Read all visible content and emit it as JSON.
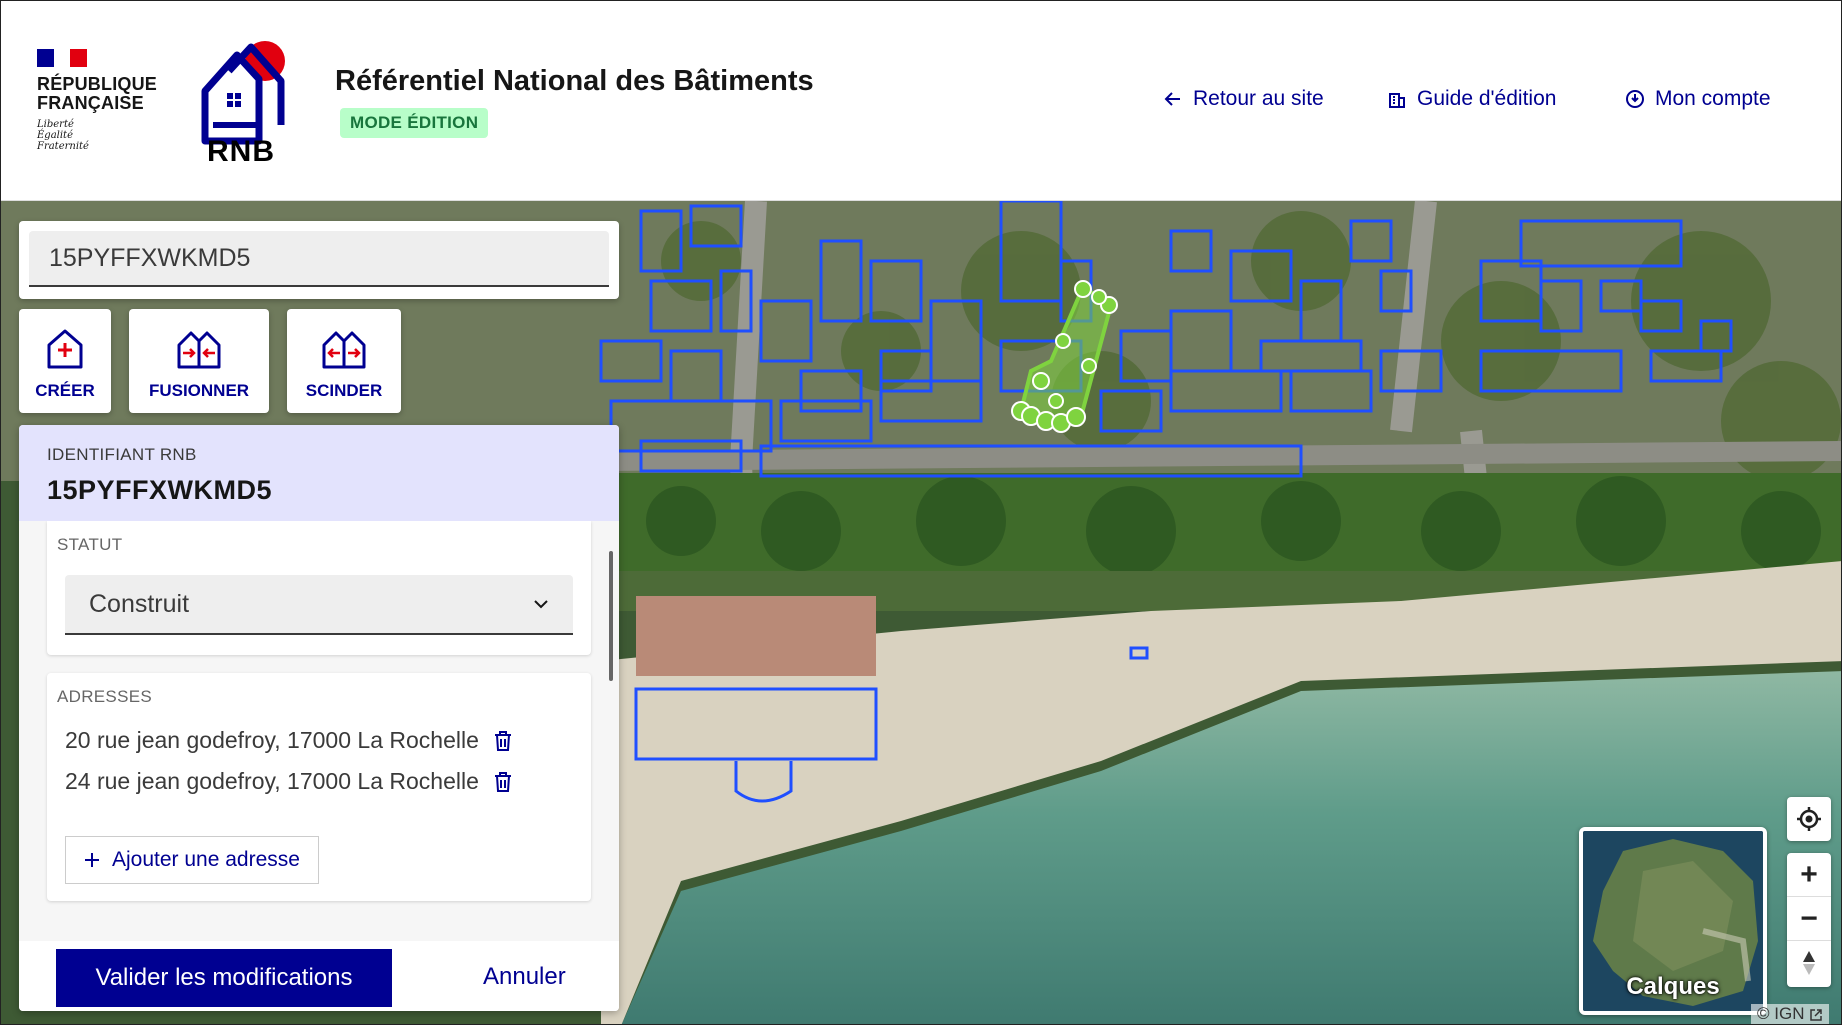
{
  "header": {
    "republic_line1": "RÉPUBLIQUE",
    "republic_line2": "FRANÇAISE",
    "motto_1": "Liberté",
    "motto_2": "Égalité",
    "motto_3": "Fraternité",
    "logo_text": "RNB",
    "title": "Référentiel National des Bâtiments",
    "mode_badge": "MODE ÉDITION",
    "nav": {
      "back": "Retour au site",
      "guide": "Guide d'édition",
      "account": "Mon compte"
    }
  },
  "search": {
    "value": "15PYFFXWKMD5"
  },
  "tools": {
    "create": "CRÉER",
    "merge": "FUSIONNER",
    "split": "SCINDER"
  },
  "panel": {
    "id_label": "IDENTIFIANT RNB",
    "id_value": "15PYFFXWKMD5",
    "status": {
      "label": "STATUT",
      "value": "Construit"
    },
    "addresses": {
      "label": "ADRESSES",
      "items": [
        "20 rue jean godefroy, 17000 La Rochelle",
        "24 rue jean godefroy, 17000 La Rochelle"
      ],
      "add_label": "Ajouter une adresse"
    },
    "validate": "Valider les modifications",
    "cancel": "Annuler"
  },
  "map": {
    "layers_label": "Calques",
    "attribution": "© IGN",
    "zoom_in": "+",
    "zoom_out": "−"
  },
  "colors": {
    "brand_blue": "#000091",
    "building_outline": "#1f4fff",
    "selected_building": "#7fd33f",
    "marianne_red": "#e1000f"
  }
}
